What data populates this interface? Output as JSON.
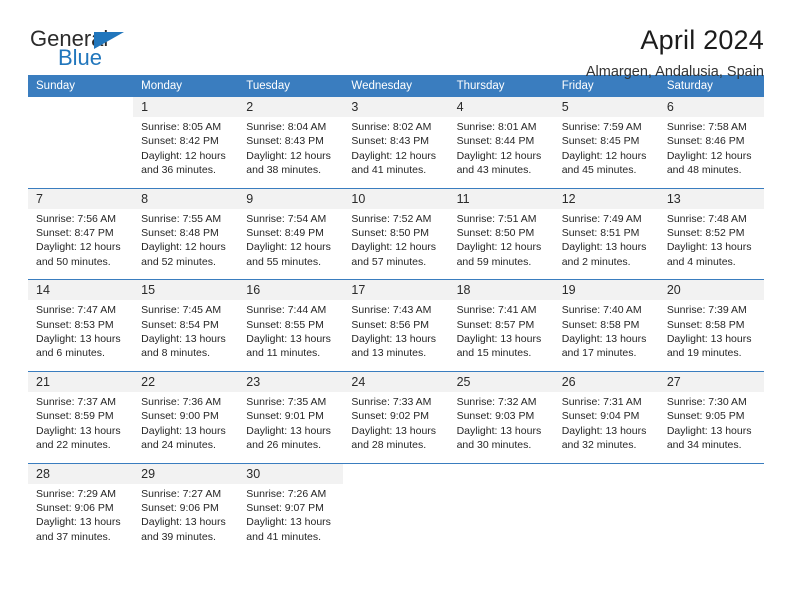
{
  "brand": {
    "word1": "General",
    "word2": "Blue",
    "triangle_color": "#2176bc"
  },
  "header": {
    "title": "April 2024",
    "subtitle": "Almargen, Andalusia, Spain"
  },
  "theme": {
    "header_blue": "#3a7dbf",
    "daynum_band": "#f2f2f2",
    "text": "#262626"
  },
  "weekdays": [
    "Sunday",
    "Monday",
    "Tuesday",
    "Wednesday",
    "Thursday",
    "Friday",
    "Saturday"
  ],
  "weeks": [
    [
      {
        "day": "",
        "lines": []
      },
      {
        "day": "1",
        "lines": [
          "Sunrise: 8:05 AM",
          "Sunset: 8:42 PM",
          "Daylight: 12 hours",
          "and 36 minutes."
        ]
      },
      {
        "day": "2",
        "lines": [
          "Sunrise: 8:04 AM",
          "Sunset: 8:43 PM",
          "Daylight: 12 hours",
          "and 38 minutes."
        ]
      },
      {
        "day": "3",
        "lines": [
          "Sunrise: 8:02 AM",
          "Sunset: 8:43 PM",
          "Daylight: 12 hours",
          "and 41 minutes."
        ]
      },
      {
        "day": "4",
        "lines": [
          "Sunrise: 8:01 AM",
          "Sunset: 8:44 PM",
          "Daylight: 12 hours",
          "and 43 minutes."
        ]
      },
      {
        "day": "5",
        "lines": [
          "Sunrise: 7:59 AM",
          "Sunset: 8:45 PM",
          "Daylight: 12 hours",
          "and 45 minutes."
        ]
      },
      {
        "day": "6",
        "lines": [
          "Sunrise: 7:58 AM",
          "Sunset: 8:46 PM",
          "Daylight: 12 hours",
          "and 48 minutes."
        ]
      }
    ],
    [
      {
        "day": "7",
        "lines": [
          "Sunrise: 7:56 AM",
          "Sunset: 8:47 PM",
          "Daylight: 12 hours",
          "and 50 minutes."
        ]
      },
      {
        "day": "8",
        "lines": [
          "Sunrise: 7:55 AM",
          "Sunset: 8:48 PM",
          "Daylight: 12 hours",
          "and 52 minutes."
        ]
      },
      {
        "day": "9",
        "lines": [
          "Sunrise: 7:54 AM",
          "Sunset: 8:49 PM",
          "Daylight: 12 hours",
          "and 55 minutes."
        ]
      },
      {
        "day": "10",
        "lines": [
          "Sunrise: 7:52 AM",
          "Sunset: 8:50 PM",
          "Daylight: 12 hours",
          "and 57 minutes."
        ]
      },
      {
        "day": "11",
        "lines": [
          "Sunrise: 7:51 AM",
          "Sunset: 8:50 PM",
          "Daylight: 12 hours",
          "and 59 minutes."
        ]
      },
      {
        "day": "12",
        "lines": [
          "Sunrise: 7:49 AM",
          "Sunset: 8:51 PM",
          "Daylight: 13 hours",
          "and 2 minutes."
        ]
      },
      {
        "day": "13",
        "lines": [
          "Sunrise: 7:48 AM",
          "Sunset: 8:52 PM",
          "Daylight: 13 hours",
          "and 4 minutes."
        ]
      }
    ],
    [
      {
        "day": "14",
        "lines": [
          "Sunrise: 7:47 AM",
          "Sunset: 8:53 PM",
          "Daylight: 13 hours",
          "and 6 minutes."
        ]
      },
      {
        "day": "15",
        "lines": [
          "Sunrise: 7:45 AM",
          "Sunset: 8:54 PM",
          "Daylight: 13 hours",
          "and 8 minutes."
        ]
      },
      {
        "day": "16",
        "lines": [
          "Sunrise: 7:44 AM",
          "Sunset: 8:55 PM",
          "Daylight: 13 hours",
          "and 11 minutes."
        ]
      },
      {
        "day": "17",
        "lines": [
          "Sunrise: 7:43 AM",
          "Sunset: 8:56 PM",
          "Daylight: 13 hours",
          "and 13 minutes."
        ]
      },
      {
        "day": "18",
        "lines": [
          "Sunrise: 7:41 AM",
          "Sunset: 8:57 PM",
          "Daylight: 13 hours",
          "and 15 minutes."
        ]
      },
      {
        "day": "19",
        "lines": [
          "Sunrise: 7:40 AM",
          "Sunset: 8:58 PM",
          "Daylight: 13 hours",
          "and 17 minutes."
        ]
      },
      {
        "day": "20",
        "lines": [
          "Sunrise: 7:39 AM",
          "Sunset: 8:58 PM",
          "Daylight: 13 hours",
          "and 19 minutes."
        ]
      }
    ],
    [
      {
        "day": "21",
        "lines": [
          "Sunrise: 7:37 AM",
          "Sunset: 8:59 PM",
          "Daylight: 13 hours",
          "and 22 minutes."
        ]
      },
      {
        "day": "22",
        "lines": [
          "Sunrise: 7:36 AM",
          "Sunset: 9:00 PM",
          "Daylight: 13 hours",
          "and 24 minutes."
        ]
      },
      {
        "day": "23",
        "lines": [
          "Sunrise: 7:35 AM",
          "Sunset: 9:01 PM",
          "Daylight: 13 hours",
          "and 26 minutes."
        ]
      },
      {
        "day": "24",
        "lines": [
          "Sunrise: 7:33 AM",
          "Sunset: 9:02 PM",
          "Daylight: 13 hours",
          "and 28 minutes."
        ]
      },
      {
        "day": "25",
        "lines": [
          "Sunrise: 7:32 AM",
          "Sunset: 9:03 PM",
          "Daylight: 13 hours",
          "and 30 minutes."
        ]
      },
      {
        "day": "26",
        "lines": [
          "Sunrise: 7:31 AM",
          "Sunset: 9:04 PM",
          "Daylight: 13 hours",
          "and 32 minutes."
        ]
      },
      {
        "day": "27",
        "lines": [
          "Sunrise: 7:30 AM",
          "Sunset: 9:05 PM",
          "Daylight: 13 hours",
          "and 34 minutes."
        ]
      }
    ],
    [
      {
        "day": "28",
        "lines": [
          "Sunrise: 7:29 AM",
          "Sunset: 9:06 PM",
          "Daylight: 13 hours",
          "and 37 minutes."
        ]
      },
      {
        "day": "29",
        "lines": [
          "Sunrise: 7:27 AM",
          "Sunset: 9:06 PM",
          "Daylight: 13 hours",
          "and 39 minutes."
        ]
      },
      {
        "day": "30",
        "lines": [
          "Sunrise: 7:26 AM",
          "Sunset: 9:07 PM",
          "Daylight: 13 hours",
          "and 41 minutes."
        ]
      },
      {
        "day": "",
        "lines": []
      },
      {
        "day": "",
        "lines": []
      },
      {
        "day": "",
        "lines": []
      },
      {
        "day": "",
        "lines": []
      }
    ]
  ]
}
